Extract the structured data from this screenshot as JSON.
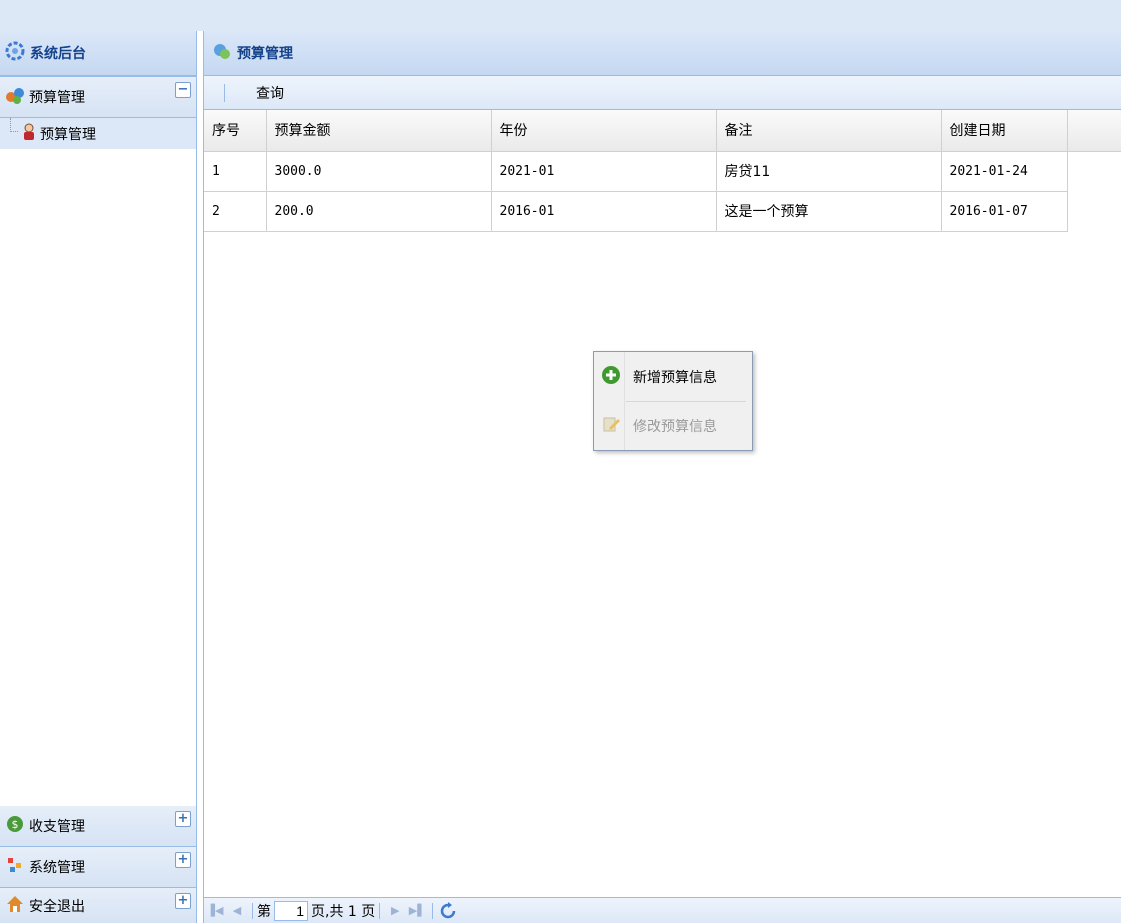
{
  "sidebar": {
    "title": "系统后台",
    "groups": [
      {
        "label": "预算管理",
        "toggle": "−",
        "items": [
          {
            "label": "预算管理"
          }
        ]
      },
      {
        "label": "收支管理",
        "toggle": "+"
      },
      {
        "label": "系统管理",
        "toggle": "+"
      },
      {
        "label": "安全退出",
        "toggle": "+"
      }
    ]
  },
  "main": {
    "title": "预算管理",
    "toolbar": {
      "query_label": "查询"
    },
    "table": {
      "columns": [
        "序号",
        "预算金额",
        "年份",
        "备注",
        "创建日期"
      ],
      "rows": [
        [
          "1",
          "3000.0",
          "2021-01",
          "房贷11",
          "2021-01-24"
        ],
        [
          "2",
          "200.0",
          "2016-01",
          "这是一个预算",
          "2016-01-07"
        ]
      ]
    },
    "context_menu": {
      "items": [
        {
          "label": "新增预算信息",
          "enabled": true
        },
        {
          "label": "修改预算信息",
          "enabled": false
        }
      ]
    },
    "pager": {
      "prefix": "第",
      "page_value": "1",
      "suffix": "页,共 1 页"
    }
  },
  "colors": {
    "accent": "#15428b",
    "border": "#99bbe8",
    "header_bg": "#dbe7f8"
  },
  "icons": [
    "gear-icon",
    "group-icon",
    "user-icon",
    "budget-icon",
    "money-icon",
    "settings-icon",
    "home-icon",
    "add-icon",
    "edit-icon",
    "refresh-icon"
  ]
}
